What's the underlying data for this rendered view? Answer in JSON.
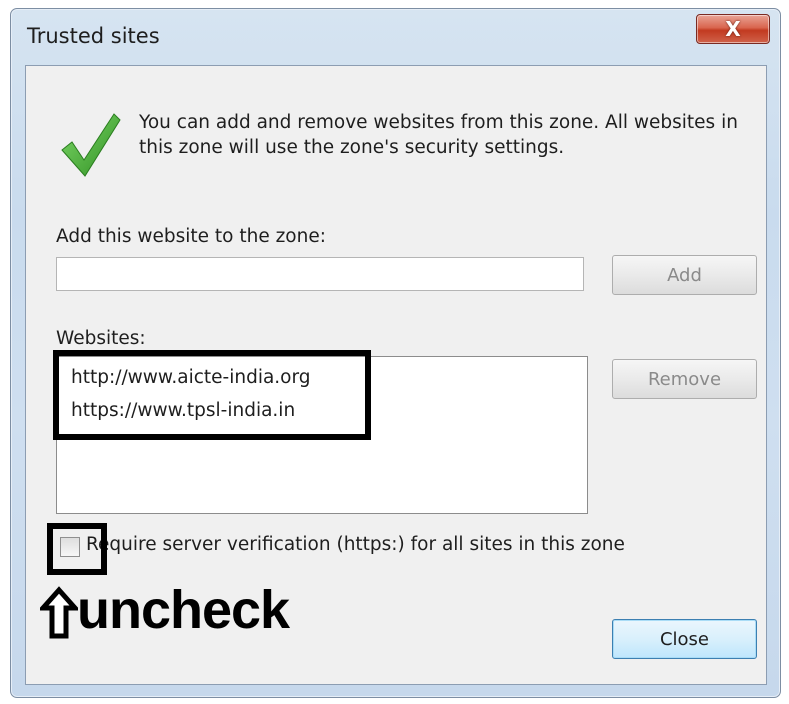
{
  "window": {
    "title": "Trusted sites",
    "close_glyph": "X"
  },
  "info": {
    "icon": "green-checkmark-icon",
    "text": "You can add and remove websites from this zone. All websites in this zone will use the zone's security settings."
  },
  "add": {
    "label": "Add this website to the zone:",
    "input_value": "",
    "button_label": "Add"
  },
  "websites": {
    "label": "Websites:",
    "items": [
      "http://www.aicte-india.org",
      "https://www.tpsl-india.in"
    ],
    "remove_label": "Remove"
  },
  "require_verification": {
    "label": "Require server verification (https:) for all sites in this zone",
    "checked": false
  },
  "annotation": {
    "text": "uncheck",
    "icon": "up-arrow-icon"
  },
  "buttons": {
    "close_label": "Close"
  },
  "colors": {
    "check_green": "#3aa22f",
    "close_red": "#c94a33",
    "default_button_border": "#3c7fb1"
  }
}
